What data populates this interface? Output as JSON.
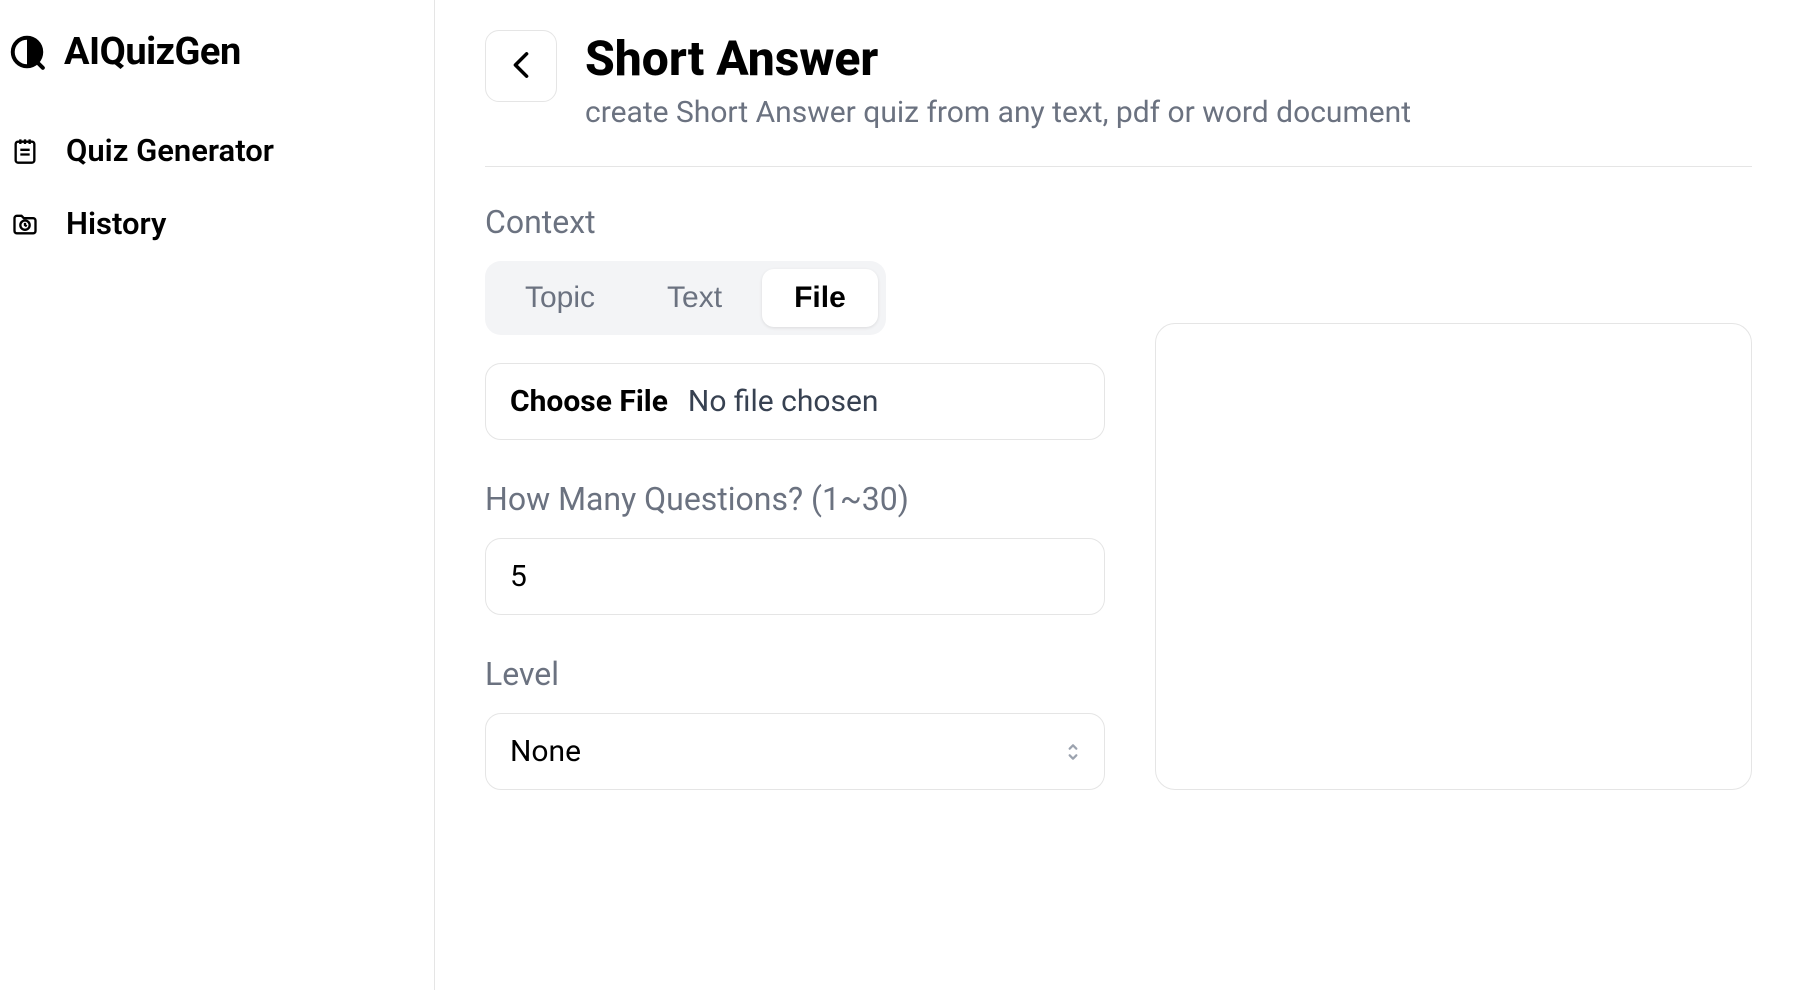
{
  "app": {
    "name": "AIQuizGen"
  },
  "sidebar": {
    "items": [
      {
        "label": "Quiz Generator",
        "icon": "notepad"
      },
      {
        "label": "History",
        "icon": "clock-folder"
      }
    ]
  },
  "header": {
    "title": "Short Answer",
    "subtitle": "create Short Answer quiz from any text, pdf or word document"
  },
  "form": {
    "context": {
      "label": "Context",
      "tabs": [
        {
          "label": "Topic",
          "active": false
        },
        {
          "label": "Text",
          "active": false
        },
        {
          "label": "File",
          "active": true
        }
      ],
      "fileButton": "Choose File",
      "fileStatus": "No file chosen"
    },
    "questions": {
      "label": "How Many Questions? (1~30)",
      "value": "5"
    },
    "level": {
      "label": "Level",
      "value": "None"
    }
  }
}
